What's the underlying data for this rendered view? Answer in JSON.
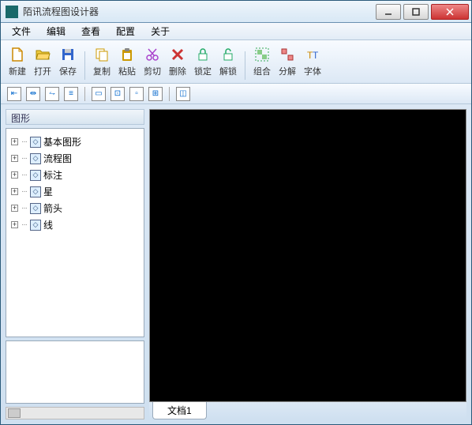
{
  "window": {
    "title": "陌讯流程图设计器"
  },
  "menubar": [
    "文件",
    "编辑",
    "查看",
    "配置",
    "关于"
  ],
  "toolbar": [
    {
      "name": "new",
      "label": "新建",
      "icon": "file-icon",
      "color": "#c80"
    },
    {
      "name": "open",
      "label": "打开",
      "icon": "folder-open-icon",
      "color": "#ec4"
    },
    {
      "name": "save",
      "label": "保存",
      "icon": "floppy-icon",
      "color": "#36c"
    },
    {
      "name": "copy",
      "label": "复制",
      "icon": "copy-icon",
      "color": "#c90"
    },
    {
      "name": "paste",
      "label": "粘贴",
      "icon": "paste-icon",
      "color": "#c90"
    },
    {
      "name": "cut",
      "label": "剪切",
      "icon": "scissors-icon",
      "color": "#a4c"
    },
    {
      "name": "delete",
      "label": "删除",
      "icon": "delete-icon",
      "color": "#c33"
    },
    {
      "name": "lock",
      "label": "锁定",
      "icon": "lock-icon",
      "color": "#2a6"
    },
    {
      "name": "unlock",
      "label": "解锁",
      "icon": "unlock-icon",
      "color": "#2a6"
    },
    {
      "name": "group",
      "label": "组合",
      "icon": "group-icon",
      "color": "#3a5"
    },
    {
      "name": "ungroup",
      "label": "分解",
      "icon": "ungroup-icon",
      "color": "#a33"
    },
    {
      "name": "font",
      "label": "字体",
      "icon": "font-icon",
      "color": "#c80"
    }
  ],
  "toolbar_separators_after": [
    2,
    8
  ],
  "toolbar2_count": 9,
  "toolbar2_separators_after": [
    3,
    7
  ],
  "sidebar": {
    "header": "图形",
    "items": [
      "基本图形",
      "流程图",
      "标注",
      "星",
      "箭头",
      "线"
    ]
  },
  "document_tab": "文档1"
}
